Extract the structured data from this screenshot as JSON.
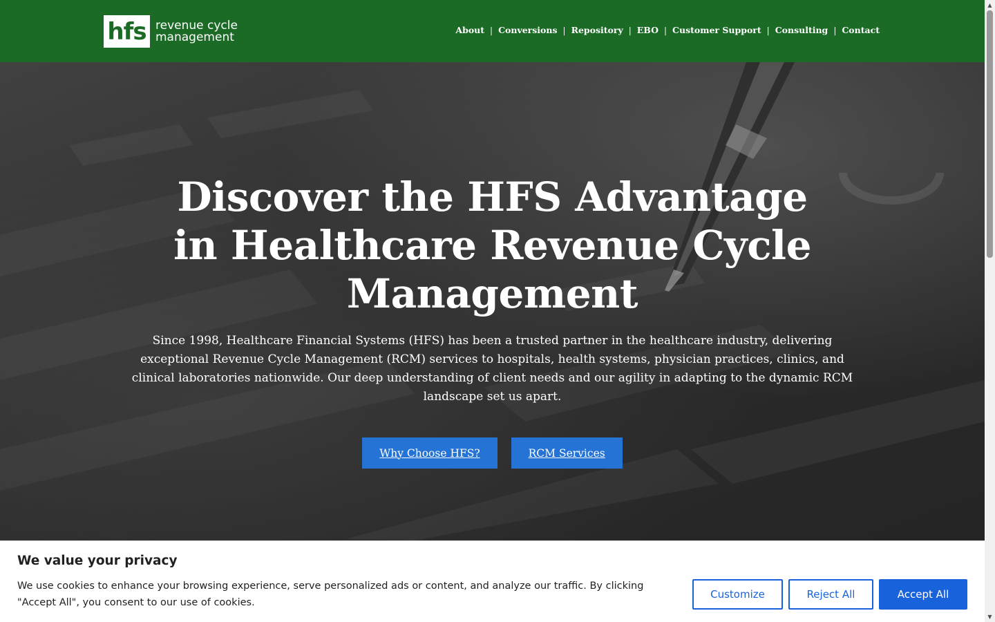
{
  "header": {
    "logo_mark": "hfs",
    "logo_line1": "revenue cycle",
    "logo_line2": "management",
    "nav": [
      "About",
      "Conversions",
      "Repository",
      "EBO",
      "Customer Support",
      "Consulting",
      "Contact"
    ],
    "separator": "|"
  },
  "hero": {
    "title": "Discover the HFS Advantage in Healthcare Revenue Cycle Management",
    "subtitle": "Since 1998, Healthcare Financial Systems (HFS) has been a trusted partner in the healthcare industry, delivering exceptional Revenue Cycle Management (RCM) services to hospitals, health systems, physician practices, clinics, and clinical laboratories nationwide. Our deep understanding of client needs and our agility in adapting to the dynamic RCM landscape set us apart.",
    "btn_primary": "Why Choose HFS?",
    "btn_secondary": "RCM Services"
  },
  "cookie": {
    "title": "We value your privacy",
    "text": "We use cookies to enhance your browsing experience, serve personalized ads or content, and analyze our traffic. By clicking \"Accept All\", you consent to our use of cookies.",
    "customize": "Customize",
    "reject": "Reject All",
    "accept": "Accept All"
  },
  "colors": {
    "header_green": "#1b6b27",
    "button_blue": "#2573d4",
    "cookie_blue": "#1863dc"
  },
  "icons": {
    "scroll_up": "arrow-up-icon",
    "scroll_down": "arrow-down-icon"
  }
}
